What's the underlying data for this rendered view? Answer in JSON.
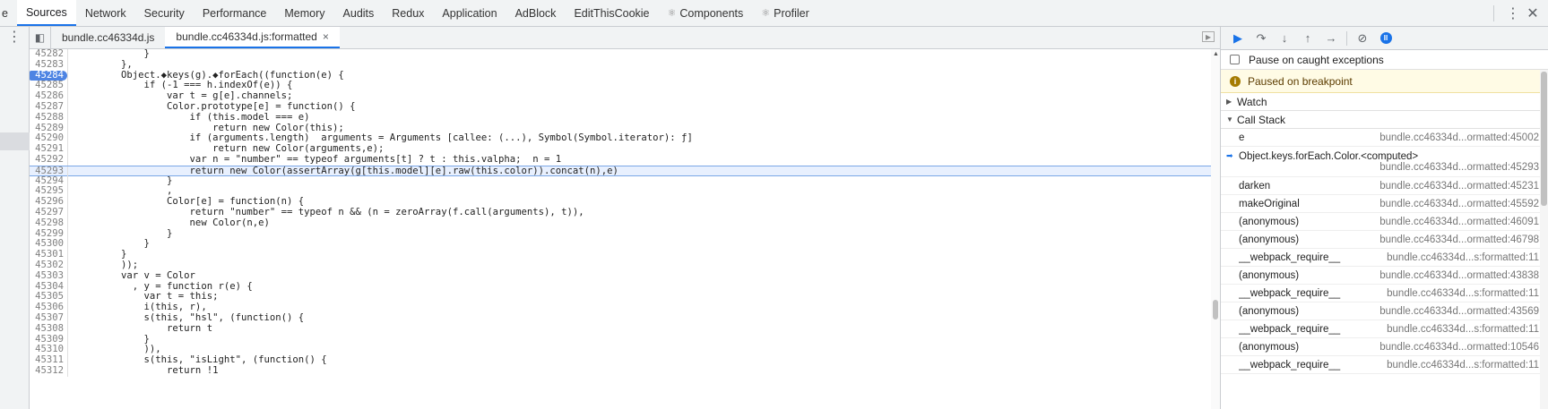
{
  "topbar": {
    "tabs": [
      {
        "label": "e",
        "prefix": ""
      },
      {
        "label": "Sources",
        "prefix": "",
        "active": true
      },
      {
        "label": "Network",
        "prefix": ""
      },
      {
        "label": "Security",
        "prefix": ""
      },
      {
        "label": "Performance",
        "prefix": ""
      },
      {
        "label": "Memory",
        "prefix": ""
      },
      {
        "label": "Audits",
        "prefix": ""
      },
      {
        "label": "Redux",
        "prefix": ""
      },
      {
        "label": "Application",
        "prefix": ""
      },
      {
        "label": "AdBlock",
        "prefix": ""
      },
      {
        "label": "EditThisCookie",
        "prefix": ""
      },
      {
        "label": "Components",
        "prefix": "⚛"
      },
      {
        "label": "Profiler",
        "prefix": "⚛"
      }
    ],
    "menu_icon": "⋮",
    "close_icon": "✕"
  },
  "editor": {
    "file_tabs": [
      {
        "label": "bundle.cc46334d.js",
        "active": false
      },
      {
        "label": "bundle.cc46334d.js:formatted",
        "active": true,
        "close": "×"
      }
    ],
    "lines": [
      {
        "n": "45282",
        "t": "            }"
      },
      {
        "n": "45283",
        "t": "        },"
      },
      {
        "n": "45284",
        "t": "        Object.◆keys(g).◆forEach((function(e) {",
        "bp": true
      },
      {
        "n": "45285",
        "t": "            if (-1 === h.indexOf(e)) {"
      },
      {
        "n": "45286",
        "t": "                var t = g[e].channels;"
      },
      {
        "n": "45287",
        "t": "                Color.prototype[e] = function() {"
      },
      {
        "n": "45288",
        "t": "                    if (this.model === e)"
      },
      {
        "n": "45289",
        "t": "                        return new Color(this);"
      },
      {
        "n": "45290",
        "t": "                    if (arguments.length)  arguments = Arguments [callee: (...), Symbol(Symbol.iterator): ƒ]"
      },
      {
        "n": "45291",
        "t": "                        return new Color(arguments,e);"
      },
      {
        "n": "45292",
        "t": "                    var n = \"number\" == typeof arguments[t] ? t : this.valpha;  n = 1"
      },
      {
        "n": "45293",
        "t": "                    return new Color(assertArray(g[this.model][e].raw(this.color)).concat(n),e)",
        "exec": true
      },
      {
        "n": "45294",
        "t": "                }"
      },
      {
        "n": "45295",
        "t": "                ,"
      },
      {
        "n": "45296",
        "t": "                Color[e] = function(n) {"
      },
      {
        "n": "45297",
        "t": "                    return \"number\" == typeof n && (n = zeroArray(f.call(arguments), t)),"
      },
      {
        "n": "45298",
        "t": "                    new Color(n,e)"
      },
      {
        "n": "45299",
        "t": "                }"
      },
      {
        "n": "45300",
        "t": "            }"
      },
      {
        "n": "45301",
        "t": "        }"
      },
      {
        "n": "45302",
        "t": "        ));"
      },
      {
        "n": "45303",
        "t": "        var v = Color"
      },
      {
        "n": "45304",
        "t": "          , y = function r(e) {"
      },
      {
        "n": "45305",
        "t": "            var t = this;"
      },
      {
        "n": "45306",
        "t": "            i(this, r),"
      },
      {
        "n": "45307",
        "t": "            s(this, \"hsl\", (function() {"
      },
      {
        "n": "45308",
        "t": "                return t"
      },
      {
        "n": "45309",
        "t": "            }"
      },
      {
        "n": "45310",
        "t": "            )),"
      },
      {
        "n": "45311",
        "t": "            s(this, \"isLight\", (function() {"
      },
      {
        "n": "45312",
        "t": "                return !1"
      }
    ]
  },
  "debugger": {
    "toolbar_icons": [
      "resume-icon",
      "step-over-icon",
      "step-into-icon",
      "step-out-icon",
      "step-icon",
      "deactivate-breakpoints-icon",
      "pause-on-exceptions-icon"
    ],
    "pause_on_caught": "Pause on caught exceptions",
    "paused_message": "Paused on breakpoint",
    "info_glyph": "i",
    "watch_label": "Watch",
    "call_stack_label": "Call Stack",
    "frames": [
      {
        "name": "e",
        "loc": "bundle.cc46334d...ormatted:45002"
      },
      {
        "name": "Object.keys.forEach.Color.<computed>",
        "loc": "bundle.cc46334d...ormatted:45293",
        "current": true
      },
      {
        "name": "darken",
        "loc": "bundle.cc46334d...ormatted:45231"
      },
      {
        "name": "makeOriginal",
        "loc": "bundle.cc46334d...ormatted:45592"
      },
      {
        "name": "(anonymous)",
        "loc": "bundle.cc46334d...ormatted:46091"
      },
      {
        "name": "(anonymous)",
        "loc": "bundle.cc46334d...ormatted:46798"
      },
      {
        "name": "__webpack_require__",
        "loc": "bundle.cc46334d...s:formatted:11"
      },
      {
        "name": "(anonymous)",
        "loc": "bundle.cc46334d...ormatted:43838"
      },
      {
        "name": "__webpack_require__",
        "loc": "bundle.cc46334d...s:formatted:11"
      },
      {
        "name": "(anonymous)",
        "loc": "bundle.cc46334d...ormatted:43569"
      },
      {
        "name": "__webpack_require__",
        "loc": "bundle.cc46334d...s:formatted:11"
      },
      {
        "name": "(anonymous)",
        "loc": "bundle.cc46334d...ormatted:10546"
      },
      {
        "name": "__webpack_require__",
        "loc": "bundle.cc46334d...s:formatted:11"
      }
    ]
  }
}
